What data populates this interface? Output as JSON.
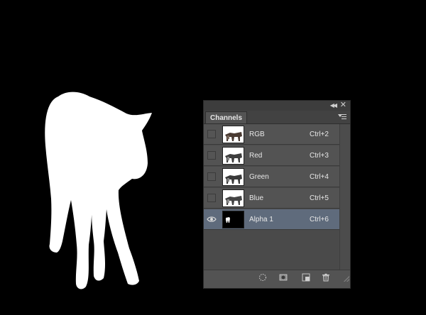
{
  "canvas": {
    "background": "#000000",
    "mask_color": "#ffffff"
  },
  "panel": {
    "tab_label": "Channels",
    "channels": [
      {
        "name": "RGB",
        "shortcut": "Ctrl+2",
        "visible": false,
        "selected": false,
        "thumb": "color"
      },
      {
        "name": "Red",
        "shortcut": "Ctrl+3",
        "visible": false,
        "selected": false,
        "thumb": "color"
      },
      {
        "name": "Green",
        "shortcut": "Ctrl+4",
        "visible": false,
        "selected": false,
        "thumb": "color"
      },
      {
        "name": "Blue",
        "shortcut": "Ctrl+5",
        "visible": false,
        "selected": false,
        "thumb": "color"
      },
      {
        "name": "Alpha 1",
        "shortcut": "Ctrl+6",
        "visible": true,
        "selected": true,
        "thumb": "mask"
      }
    ],
    "bottom_icons": [
      "load-selection-icon",
      "save-selection-icon",
      "new-channel-icon",
      "trash-icon"
    ]
  }
}
